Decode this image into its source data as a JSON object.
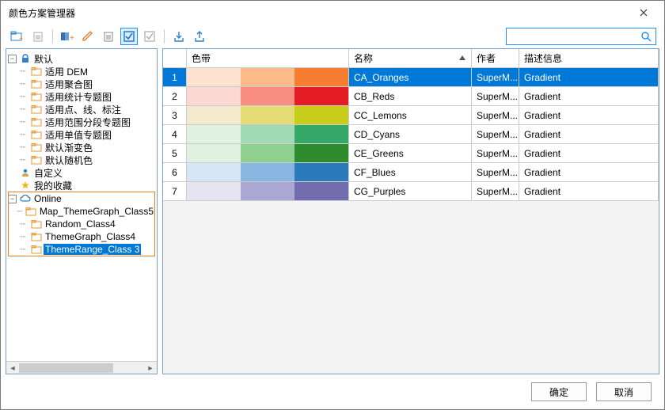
{
  "window": {
    "title": "颜色方案管理器"
  },
  "search": {
    "placeholder": ""
  },
  "tree": {
    "default": {
      "label": "默认",
      "children": [
        "适用 DEM",
        "适用聚合图",
        "适用统计专题图",
        "适用点、线、标注",
        "适用范围分段专题图",
        "适用单值专题图",
        "默认渐变色",
        "默认随机色"
      ]
    },
    "custom": "自定义",
    "favorites": "我的收藏",
    "online": {
      "label": "Online",
      "children": [
        "Map_ThemeGraph_Class5",
        "Random_Class4",
        "ThemeGraph_Class4",
        "ThemeRange_Class 3"
      ]
    }
  },
  "table": {
    "headers": {
      "ramp": "色带",
      "name": "名称",
      "author": "作者",
      "desc": "描述信息"
    },
    "rows": [
      {
        "idx": "1",
        "name": "CA_Oranges",
        "author": "SuperM...",
        "desc": "Gradient",
        "colors": [
          "#fde2cf",
          "#fdba8a",
          "#f67e32"
        ]
      },
      {
        "idx": "2",
        "name": "CB_Reds",
        "author": "SuperM...",
        "desc": "Gradient",
        "colors": [
          "#fcd8d2",
          "#f88e82",
          "#e41c23"
        ]
      },
      {
        "idx": "3",
        "name": "CC_Lemons",
        "author": "SuperM...",
        "desc": "Gradient",
        "colors": [
          "#f3e9cd",
          "#e6dc75",
          "#c8cc1b"
        ]
      },
      {
        "idx": "4",
        "name": "CD_Cyans",
        "author": "SuperM...",
        "desc": "Gradient",
        "colors": [
          "#e1f1e1",
          "#a0dab7",
          "#35a967"
        ]
      },
      {
        "idx": "5",
        "name": "CE_Greens",
        "author": "SuperM...",
        "desc": "Gradient",
        "colors": [
          "#e1f1e1",
          "#8fcf8f",
          "#2e8b2e"
        ]
      },
      {
        "idx": "6",
        "name": "CF_Blues",
        "author": "SuperM...",
        "desc": "Gradient",
        "colors": [
          "#d6e6f4",
          "#87b7e0",
          "#2b7bba"
        ]
      },
      {
        "idx": "7",
        "name": "CG_Purples",
        "author": "SuperM...",
        "desc": "Gradient",
        "colors": [
          "#e5e4f0",
          "#aaa8d2",
          "#726dae"
        ]
      }
    ]
  },
  "footer": {
    "ok": "确定",
    "cancel": "取消"
  }
}
